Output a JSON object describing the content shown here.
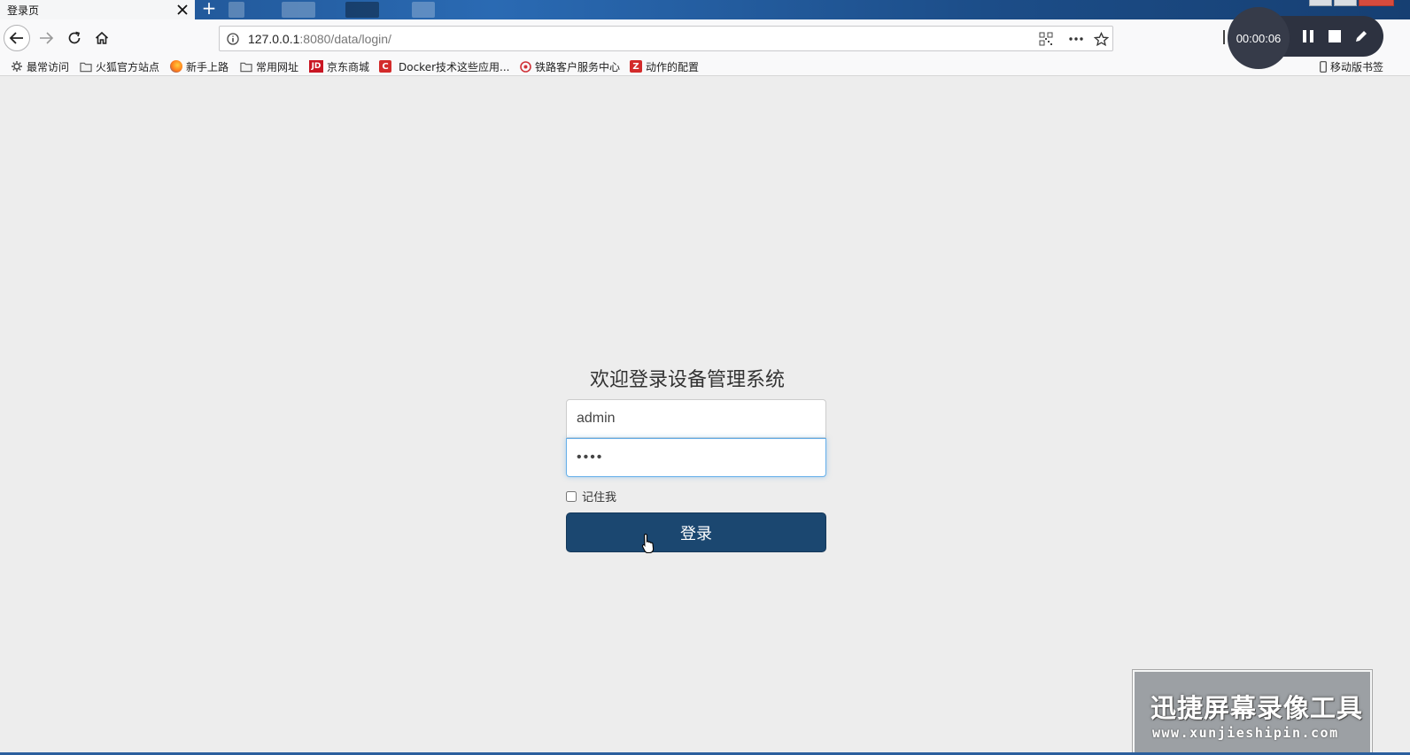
{
  "browser": {
    "tab_title": "登录页",
    "url_host": "127.0.0.1",
    "url_path": ":8080/data/login/"
  },
  "bookmarks": [
    {
      "label": "最常访问",
      "icon": "gear-icon"
    },
    {
      "label": "火狐官方站点",
      "icon": "folder-icon"
    },
    {
      "label": "新手上路",
      "icon": "firefox-icon"
    },
    {
      "label": "常用网址",
      "icon": "folder-icon"
    },
    {
      "label": "京东商城",
      "icon": "jd-icon",
      "badge": "JD"
    },
    {
      "label": "Docker技术这些应用...",
      "icon": "c-logo-icon",
      "badge": "C"
    },
    {
      "label": "铁路客户服务中心",
      "icon": "railway-icon"
    },
    {
      "label": "动作的配置",
      "icon": "z-logo-icon",
      "badge": "Z"
    }
  ],
  "mobile_bookmarks": "移动版书签",
  "recorder": {
    "time": "00:00:06"
  },
  "login": {
    "title": "欢迎登录设备管理系统",
    "username_value": "admin",
    "password_value": "••••",
    "remember_label": "记住我",
    "submit_label": "登录"
  },
  "watermark": {
    "cn": "迅捷屏幕录像工具",
    "en": "www.xunjieshipin.com"
  },
  "colors": {
    "button": "#1b4770",
    "background": "#ededed",
    "focus": "#66afe9"
  }
}
